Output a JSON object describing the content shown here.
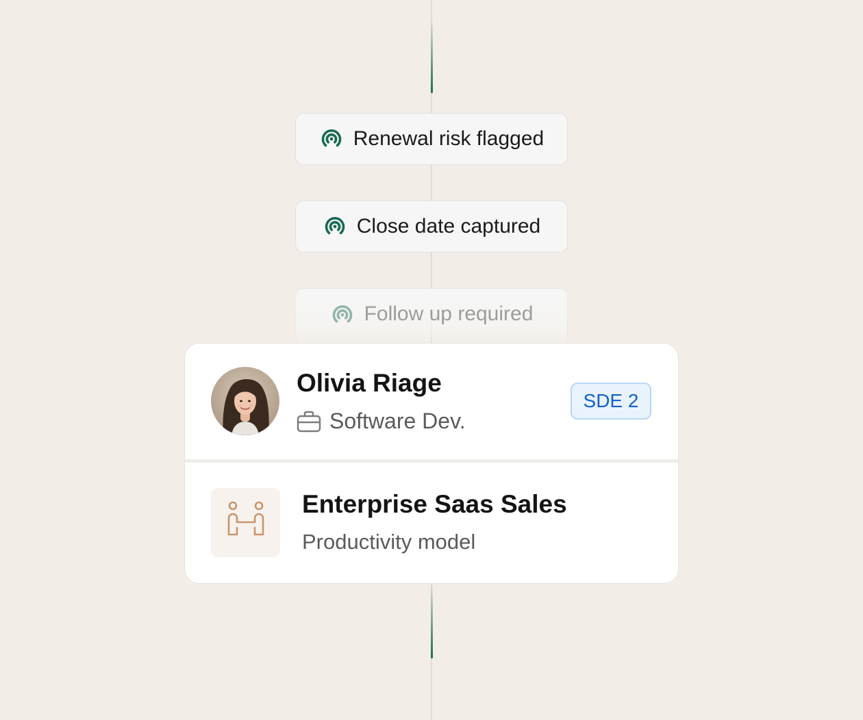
{
  "timeline": {
    "events": [
      {
        "label": "Renewal risk flagged",
        "icon": "radar-signal-icon",
        "state": "active"
      },
      {
        "label": "Close date captured",
        "icon": "radar-signal-icon",
        "state": "active"
      },
      {
        "label": "Follow up required",
        "icon": "radar-signal-icon",
        "state": "faded"
      }
    ]
  },
  "profile": {
    "name": "Olivia Riage",
    "role": "Software Dev.",
    "role_icon": "briefcase-icon",
    "badge": "SDE 2"
  },
  "model": {
    "title": "Enterprise Saas Sales",
    "subtitle": "Productivity model",
    "icon": "two-people-handshake-icon"
  },
  "colors": {
    "background": "#f2eee7",
    "accent_green": "#1b6a56",
    "badge_blue": "#1560c7",
    "model_icon": "#c9946a"
  }
}
